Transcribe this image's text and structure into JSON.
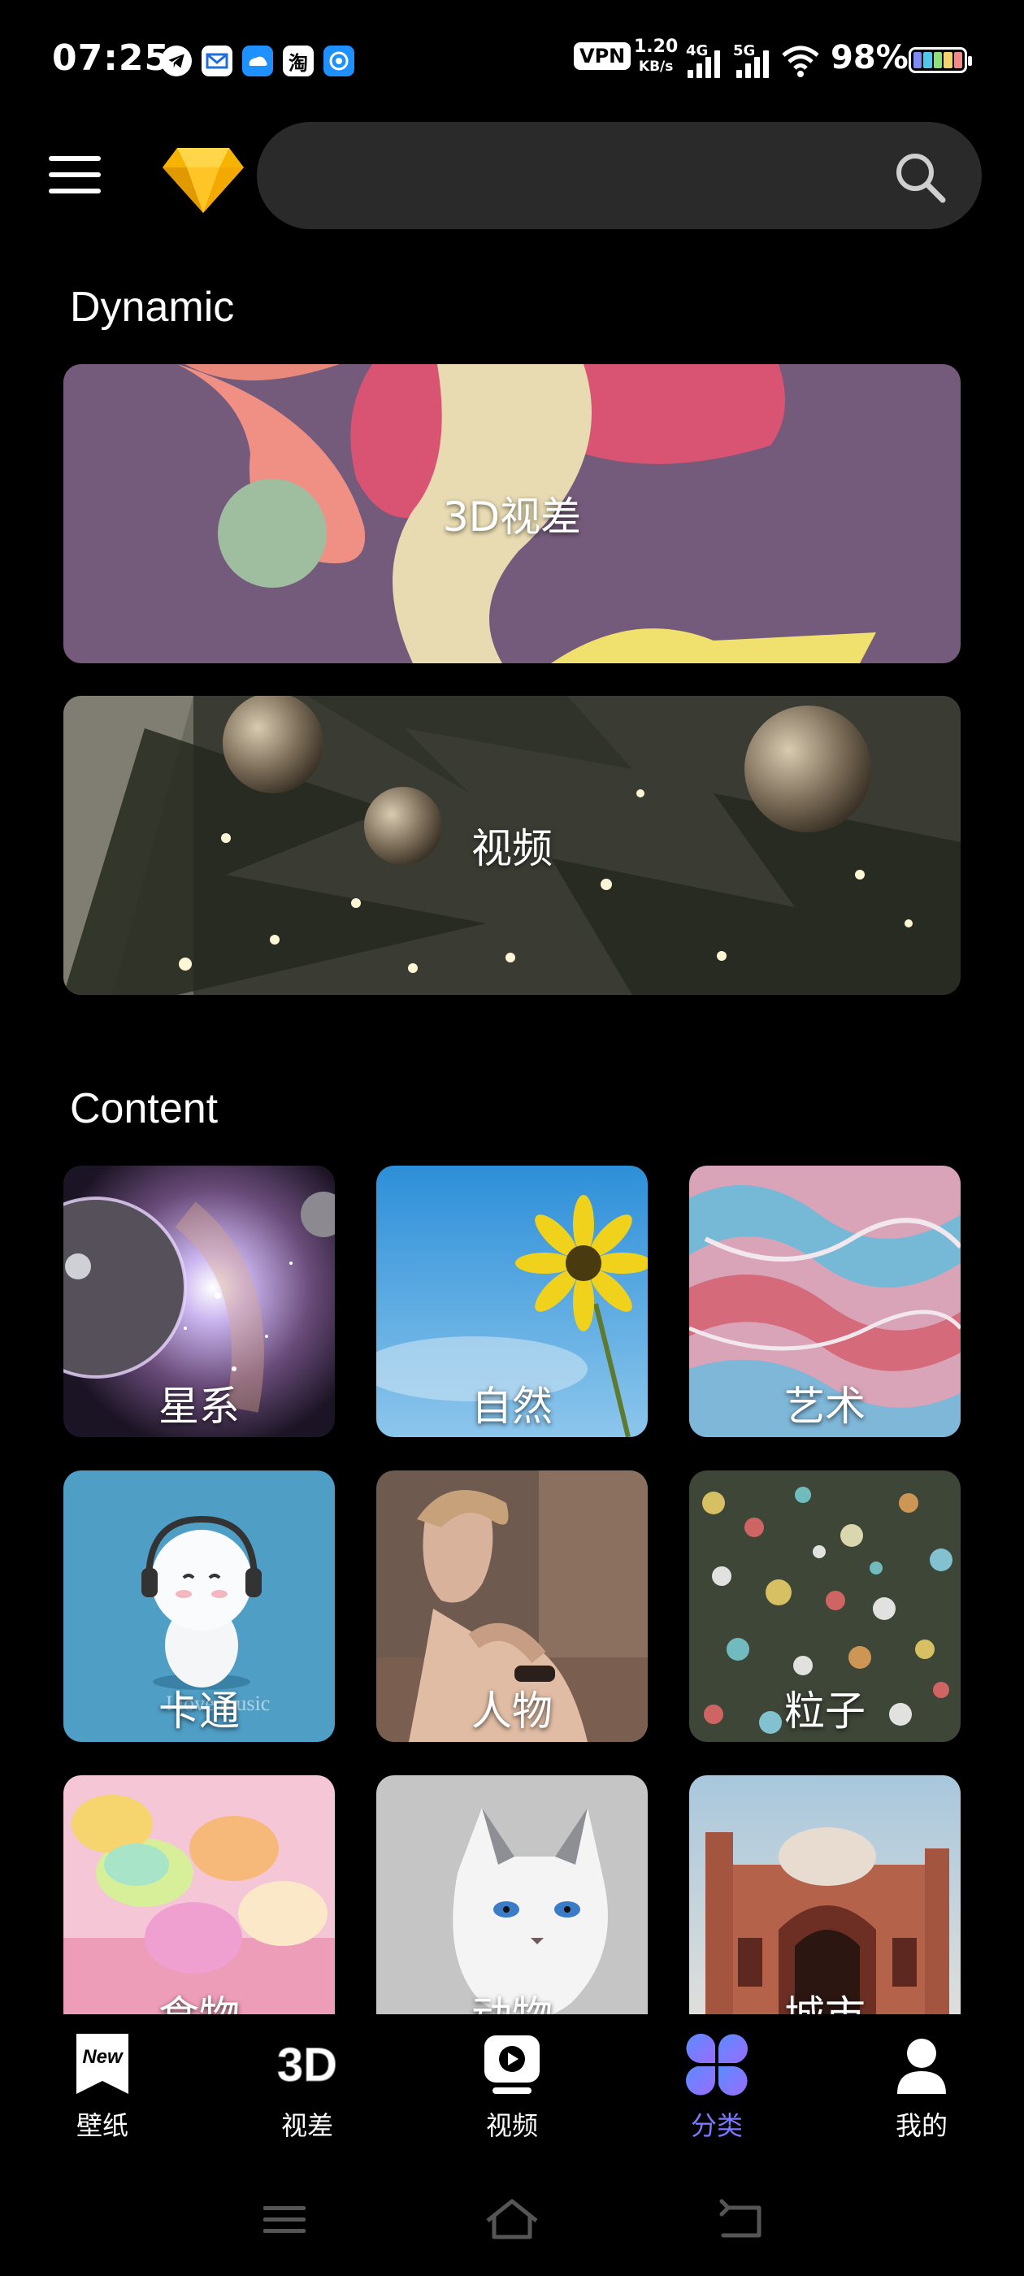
{
  "status_bar": {
    "time": "07:25",
    "notifications": [
      "telegram-icon",
      "mail-icon",
      "cloud-icon",
      "taobao-icon",
      "browser-icon"
    ],
    "taobao_label": "淘",
    "vpn": "VPN",
    "speed_value": "1.20",
    "speed_unit": "KB/s",
    "net1": "4G",
    "net2": "5G",
    "battery": "98%"
  },
  "top_bar": {
    "menu_icon": "hamburger-icon",
    "vip_icon": "diamond-icon",
    "search_placeholder": "",
    "search_icon": "search-icon"
  },
  "dynamic": {
    "title": "Dynamic",
    "items": [
      {
        "label": "3D视差"
      },
      {
        "label": "视频"
      }
    ]
  },
  "content": {
    "title": "Content",
    "items": [
      {
        "label": "星系"
      },
      {
        "label": "自然"
      },
      {
        "label": "艺术"
      },
      {
        "label": "卡通"
      },
      {
        "label": "人物"
      },
      {
        "label": "粒子"
      },
      {
        "label": "食物"
      },
      {
        "label": "动物"
      },
      {
        "label": "城市"
      }
    ],
    "cartoon_caption": "I love music"
  },
  "bottom_nav": {
    "active_color": "#7a79ff",
    "items": [
      {
        "label": "壁纸",
        "icon": "new-badge-icon"
      },
      {
        "label": "视差",
        "icon": "3d-icon"
      },
      {
        "label": "视频",
        "icon": "play-icon"
      },
      {
        "label": "分类",
        "icon": "four-petal-icon",
        "active": true
      },
      {
        "label": "我的",
        "icon": "person-icon"
      }
    ],
    "new_badge_text": "New",
    "three_d_text": "3D"
  },
  "system_nav": [
    "menu-icon",
    "home-icon",
    "back-icon"
  ]
}
